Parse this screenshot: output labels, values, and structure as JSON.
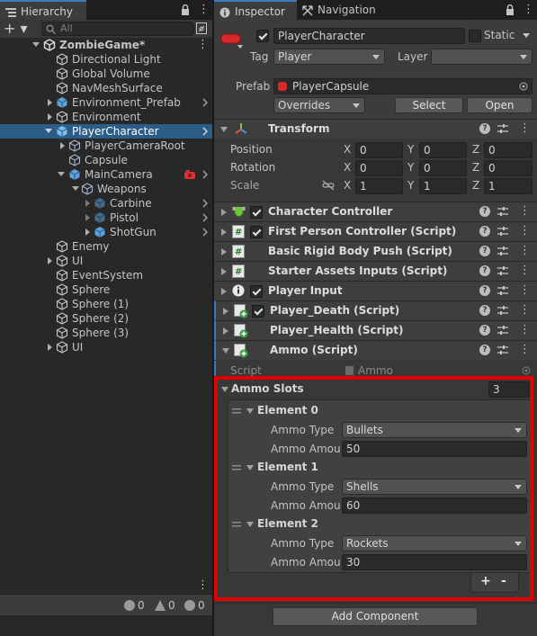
{
  "colors": {
    "selection": "#2c5d87",
    "tab_accent": "#3a79bb",
    "prefab_blue": "#7fb3e8",
    "highlight_box": "#e30000",
    "record_red": "#d93030"
  },
  "hierarchy": {
    "tab_label": "Hierarchy",
    "search_placeholder": "All",
    "add_button": "+ ▾",
    "tree": [
      {
        "label": "ZombieGame*",
        "icon": "unity-scene-icon"
      },
      {
        "label": "Directional Light",
        "icon": "gameobject-icon"
      },
      {
        "label": "Global Volume",
        "icon": "gameobject-icon"
      },
      {
        "label": "NavMeshSurface",
        "icon": "gameobject-icon"
      },
      {
        "label": "Environment_Prefab",
        "icon": "prefab-icon"
      },
      {
        "label": "Environment",
        "icon": "gameobject-icon"
      },
      {
        "label": "PlayerCharacter",
        "icon": "prefab-icon"
      },
      {
        "label": "PlayerCameraRoot",
        "icon": "gameobject-icon"
      },
      {
        "label": "Capsule",
        "icon": "gameobject-icon"
      },
      {
        "label": "MainCamera",
        "icon": "prefab-icon"
      },
      {
        "label": "Weapons",
        "icon": "gameobject-icon"
      },
      {
        "label": "Carbine",
        "icon": "prefab-icon"
      },
      {
        "label": "Pistol",
        "icon": "prefab-icon"
      },
      {
        "label": "ShotGun",
        "icon": "prefab-icon"
      },
      {
        "label": "Enemy",
        "icon": "gameobject-icon"
      },
      {
        "label": "UI",
        "icon": "gameobject-icon"
      },
      {
        "label": "EventSystem",
        "icon": "gameobject-icon"
      },
      {
        "label": "Sphere",
        "icon": "gameobject-icon"
      },
      {
        "label": "Sphere (1)",
        "icon": "gameobject-icon"
      },
      {
        "label": "Sphere (2)",
        "icon": "gameobject-icon"
      },
      {
        "label": "Sphere (3)",
        "icon": "gameobject-icon"
      },
      {
        "label": "UI",
        "icon": "gameobject-icon"
      }
    ],
    "console_counts": {
      "info": "0",
      "warning": "0",
      "error": "0"
    }
  },
  "inspector": {
    "tabs": [
      {
        "label": "Inspector",
        "icon": "info-icon"
      },
      {
        "label": "Navigation",
        "icon": "navigation-icon"
      }
    ],
    "object": {
      "name": "PlayerCharacter",
      "active": true,
      "static_label": "Static",
      "tag_label": "Tag",
      "tag_value": "Player",
      "layer_label": "Layer",
      "layer_value": "",
      "prefab_label": "Prefab",
      "prefab_value": "PlayerCapsule",
      "overrides_label": "Overrides",
      "select_label": "Select",
      "open_label": "Open"
    },
    "transform": {
      "title": "Transform",
      "rows": [
        {
          "label": "Position",
          "x": "0",
          "y": "0",
          "z": "0"
        },
        {
          "label": "Rotation",
          "x": "0",
          "y": "0",
          "z": "0"
        },
        {
          "label": "Scale",
          "x": "1",
          "y": "1",
          "z": "1"
        }
      ],
      "axis": {
        "x": "X",
        "y": "Y",
        "z": "Z"
      }
    },
    "components": [
      {
        "name": "Character Controller",
        "icon": "character-controller-icon"
      },
      {
        "name": "First Person Controller (Script)",
        "icon": "script-icon"
      },
      {
        "name": "Basic Rigid Body Push (Script)",
        "icon": "script-icon"
      },
      {
        "name": "Starter Assets Inputs (Script)",
        "icon": "script-icon"
      },
      {
        "name": "Player Input",
        "icon": "player-input-icon"
      },
      {
        "name": "Player_Death (Script)",
        "icon": "script-added-icon"
      },
      {
        "name": "Player_Health (Script)",
        "icon": "script-added-icon"
      },
      {
        "name": "Ammo (Script)",
        "icon": "script-added-icon"
      }
    ],
    "ammo": {
      "script_label": "Script",
      "script_value": "Ammo",
      "slots_label": "Ammo Slots",
      "slots_count": "3",
      "type_label": "Ammo Type",
      "amount_label": "Ammo Amour",
      "elements": [
        {
          "title": "Element 0",
          "type": "Bullets",
          "amount": "50"
        },
        {
          "title": "Element 1",
          "type": "Shells",
          "amount": "60"
        },
        {
          "title": "Element 2",
          "type": "Rockets",
          "amount": "30"
        }
      ],
      "add_label": "+",
      "remove_label": "-"
    },
    "add_component_label": "Add Component"
  }
}
